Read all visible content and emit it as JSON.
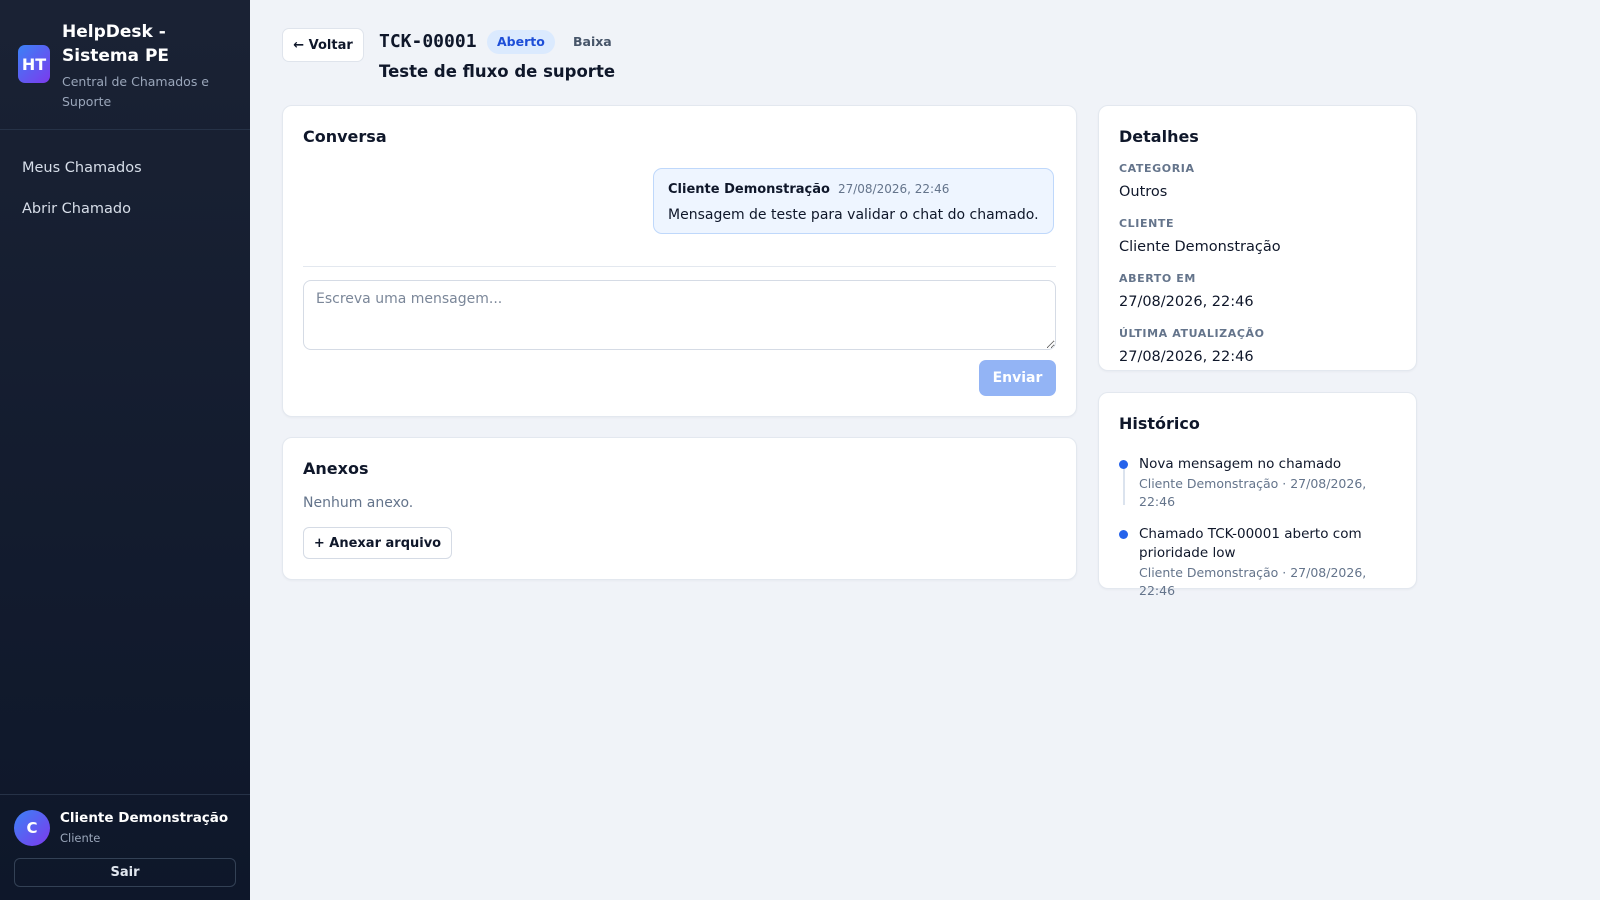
{
  "sidebar": {
    "logo_initials": "HT",
    "app_title": "HelpDesk - Sistema PE",
    "app_subtitle": "Central de Chamados e Suporte",
    "nav": [
      {
        "label": "Meus Chamados"
      },
      {
        "label": "Abrir Chamado"
      }
    ],
    "user": {
      "initial": "C",
      "name": "Cliente Demonstração",
      "role": "Cliente"
    },
    "logout_label": "Sair"
  },
  "header": {
    "back_label": "← Voltar",
    "ticket_id": "TCK-00001",
    "status": "Aberto",
    "priority": "Baixa",
    "title": "Teste de fluxo de suporte"
  },
  "conversation": {
    "title": "Conversa",
    "messages": [
      {
        "author": "Cliente Demonstração",
        "time": "27/08/2026, 22:46",
        "body": "Mensagem de teste para validar o chat do chamado."
      }
    ],
    "composer_placeholder": "Escreva uma mensagem...",
    "send_label": "Enviar"
  },
  "attachments": {
    "title": "Anexos",
    "empty_text": "Nenhum anexo.",
    "add_label": "+ Anexar arquivo"
  },
  "details": {
    "title": "Detalhes",
    "fields": [
      {
        "label": "CATEGORIA",
        "value": "Outros"
      },
      {
        "label": "CLIENTE",
        "value": "Cliente Demonstração"
      },
      {
        "label": "ABERTO EM",
        "value": "27/08/2026, 22:46"
      },
      {
        "label": "ÚLTIMA ATUALIZAÇÃO",
        "value": "27/08/2026, 22:46"
      }
    ]
  },
  "history": {
    "title": "Histórico",
    "events": [
      {
        "text": "Nova mensagem no chamado",
        "meta": "Cliente Demonstração · 27/08/2026, 22:46"
      },
      {
        "text": "Chamado TCK-00001 aberto com prioridade low",
        "meta": "Cliente Demonstração · 27/08/2026, 22:46"
      }
    ]
  },
  "colors": {
    "sidebar_bg": "#1a2234",
    "accent": "#2563eb",
    "status_badge_bg": "#dbeafe",
    "send_button": "#93b4f5"
  }
}
